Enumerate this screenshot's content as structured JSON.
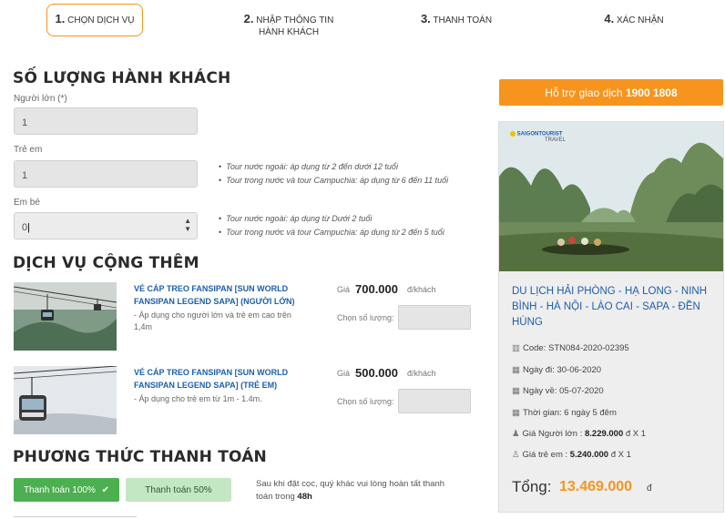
{
  "steps": [
    {
      "num": "1.",
      "label": "CHỌN DỊCH VỤ"
    },
    {
      "num": "2.",
      "label": "NHẬP THÔNG TIN",
      "label2": "HÀNH KHÁCH"
    },
    {
      "num": "3.",
      "label": "THANH TOÁN"
    },
    {
      "num": "4.",
      "label": "XÁC NHẬN"
    }
  ],
  "passengers": {
    "title": "SỐ LƯỢNG HÀNH KHÁCH",
    "adult_label": "Người lớn (*)",
    "adult_value": "1",
    "child_label": "Trẻ em",
    "child_value": "1",
    "child_notes": [
      "Tour nước ngoài: áp dụng từ 2 đến dưới 12 tuổi",
      "Tour trong nước và tour Campuchia: áp dụng từ 6 đến 11 tuổi"
    ],
    "infant_label": "Em bé",
    "infant_value": "0",
    "infant_notes": [
      "Tour nước ngoài: áp dụng từ Dưới 2 tuổi",
      "Tour trong nước và tour Campuchia: áp dụng từ 2 đến 5 tuổi"
    ]
  },
  "extras": {
    "title": "DỊCH VỤ CỘNG THÊM",
    "items": [
      {
        "title_l1": "VÉ CÁP TREO FANSIPAN [SUN WORLD",
        "title_l2": "FANSIPAN LEGEND SAPA] (NGƯỜI LỚN)",
        "desc_l1": "- Áp dụng cho người lớn và trẻ em cao trên",
        "desc_l2": "1,4m",
        "price_label": "Giá",
        "price": "700.000",
        "unit": "đ/khách",
        "qty_label": "Chọn số lượng:"
      },
      {
        "title_l1": "VÉ CÁP TREO FANSIPAN [SUN WORLD",
        "title_l2": "FANSIPAN LEGEND SAPA] (TRẺ EM)",
        "desc_l1": "- Áp dụng cho trẻ em từ 1m - 1.4m.",
        "desc_l2": "",
        "price_label": "Giá",
        "price": "500.000",
        "unit": "đ/khách",
        "qty_label": "Chọn số lượng:"
      }
    ]
  },
  "payment": {
    "title": "PHƯƠNG THỨC THANH TOÁN",
    "full_label": "Thanh toán 100%",
    "half_label": "Thanh toán 50%",
    "note_l1": "Sau khi đặt cọc, quý khác vui lòng hoàn tất thanh",
    "note_l2": "toán trong ",
    "note_bold": "48h"
  },
  "sidebar": {
    "hotline_text": "Hỗ trợ giao dịch ",
    "hotline_number": "1900 1808",
    "logo_text": "SAIGONTOURIST",
    "logo_sub": "TRAVEL",
    "tour_title": "DU LỊCH HẢI PHÒNG - HẠ LONG - NINH BÌNH - HÀ NỘI - LÀO CAI - SAPA - ĐỀN HÙNG",
    "code_label": "Code: ",
    "code": "STN084-2020-02395",
    "depart_label": "Ngày đi: ",
    "depart": "30-06-2020",
    "return_label": "Ngày về: ",
    "return": "05-07-2020",
    "duration_label": "Thời gian: ",
    "duration": "6 ngày 5 đêm",
    "adult_price_label": "Giá Người lớn : ",
    "adult_price": "8.229.000",
    "adult_price_suffix": " đ X 1",
    "child_price_label": "Giá trẻ em : ",
    "child_price": "5.240.000",
    "child_price_suffix": " đ X 1",
    "total_label": "Tổng:",
    "total": "13.469.000",
    "currency": "đ"
  },
  "colors": {
    "accent": "#f7941d",
    "link": "#1d5fa8",
    "pay_active": "#4caf50",
    "pay_inactive": "#c3e6c3"
  }
}
